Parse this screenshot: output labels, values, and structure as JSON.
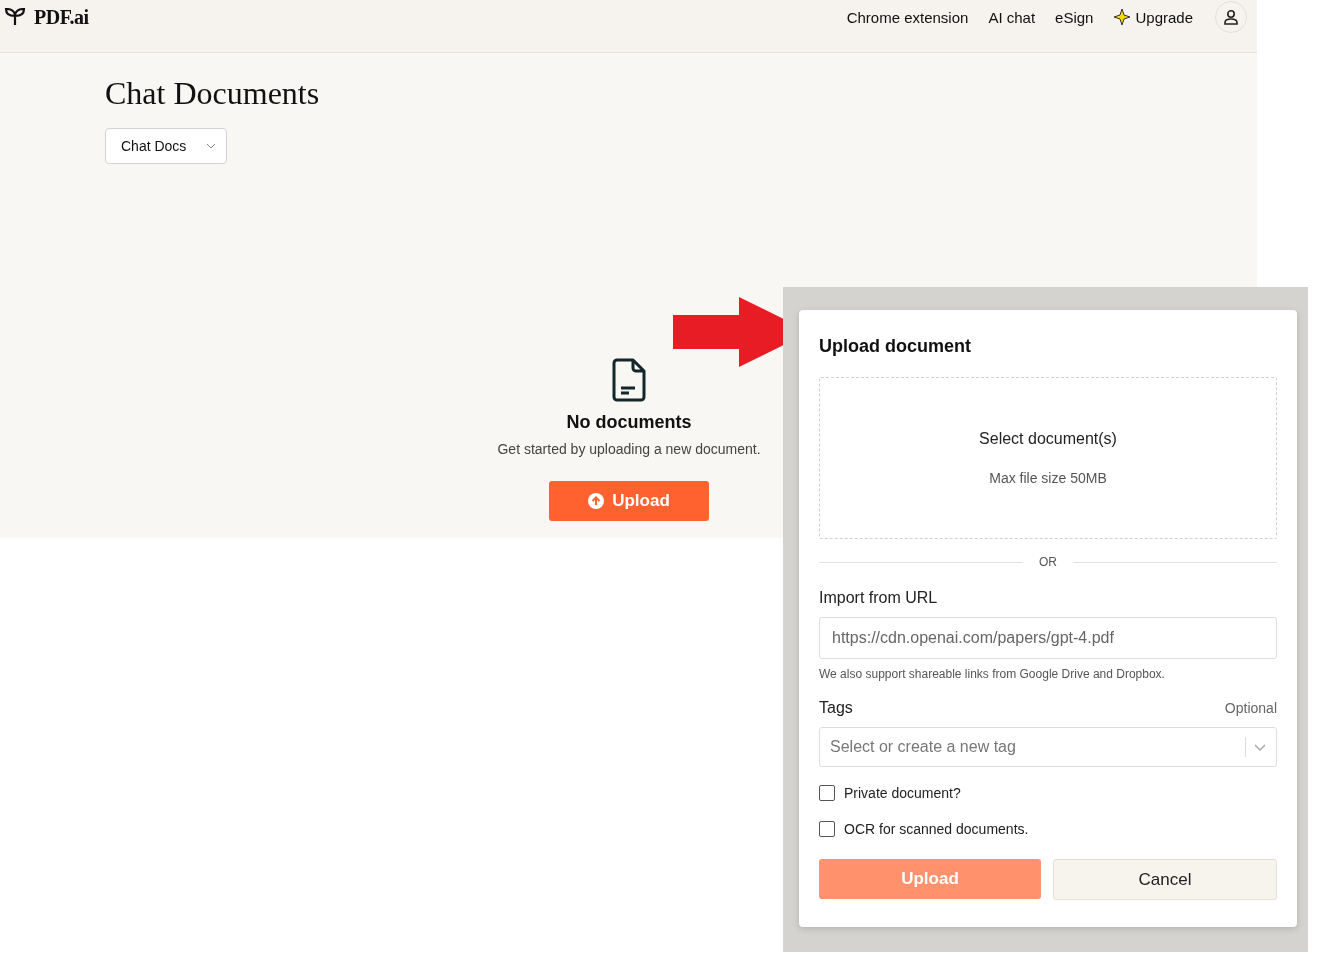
{
  "header": {
    "logo": "PDF.ai",
    "nav": [
      {
        "label": "Chrome extension",
        "kind": "link"
      },
      {
        "label": "AI chat",
        "kind": "link"
      },
      {
        "label": "eSign",
        "kind": "link"
      },
      {
        "label": "Upgrade",
        "kind": "upgrade"
      }
    ]
  },
  "page": {
    "title": "Chat Documents",
    "dropdown": "Chat Docs"
  },
  "empty_state": {
    "title": "No documents",
    "text": "Get started by uploading a new document.",
    "button": "Upload"
  },
  "modal": {
    "title": "Upload document",
    "dropzone": {
      "label": "Select document(s)",
      "hint": "Max file size 50MB"
    },
    "divider": "OR",
    "url": {
      "label": "Import from URL",
      "placeholder": "https://cdn.openai.com/papers/gpt-4.pdf",
      "help": "We also support shareable links from Google Drive and Dropbox."
    },
    "tags": {
      "label": "Tags",
      "note": "Optional",
      "placeholder": "Select or create a new tag"
    },
    "options": [
      {
        "label": "Private document?",
        "checked": false
      },
      {
        "label": "OCR for scanned documents.",
        "checked": false
      }
    ],
    "upload": {
      "label": "Upload",
      "disabled": true
    },
    "cancel": "Cancel"
  }
}
